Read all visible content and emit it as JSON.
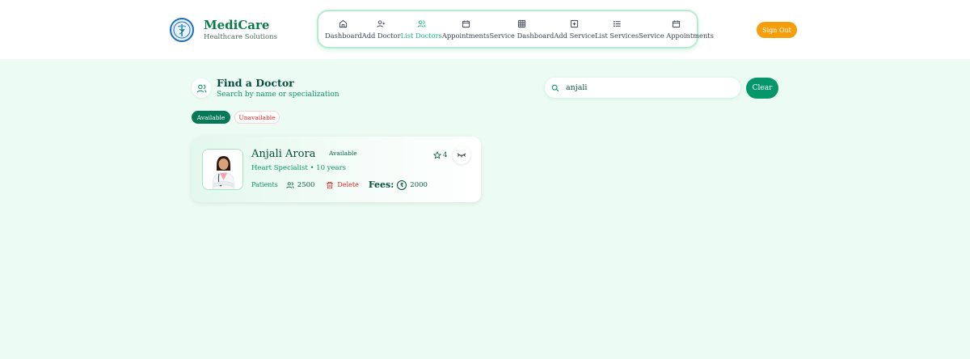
{
  "brand": {
    "name": "MediCare",
    "subtitle": "Healthcare Solutions",
    "logo_icon": "caduceus-icon"
  },
  "nav": {
    "items": [
      {
        "label": "Dashboard",
        "icon": "home-icon",
        "active": false
      },
      {
        "label": "Add Doctor",
        "icon": "user-plus-icon",
        "active": false
      },
      {
        "label": "List Doctors",
        "icon": "users-icon",
        "active": true
      },
      {
        "label": "Appointments",
        "icon": "calendar-icon",
        "active": false
      },
      {
        "label": "Service Dashboard",
        "icon": "grid-icon",
        "active": false
      },
      {
        "label": "Add Service",
        "icon": "plus-square-icon",
        "active": false
      },
      {
        "label": "List Services",
        "icon": "list-icon",
        "active": false
      },
      {
        "label": "Service Appointments",
        "icon": "calendar-icon",
        "active": false
      }
    ],
    "signout_label": "Sign Out"
  },
  "find": {
    "title": "Find a Doctor",
    "subtitle": "Search by name or specialization",
    "search_value": "anjali",
    "clear_label": "Clear",
    "filters": {
      "available": "Available",
      "unavailable": "Unavailable"
    }
  },
  "doctor": {
    "name": "Anjali Arora",
    "status": "Available",
    "rating": "4",
    "specialization": "Heart Specialist • 10 years",
    "patients_label": "Patients",
    "patients_count": "2500",
    "delete_label": "Delete",
    "fees_label": "Fees:",
    "fees_value": "2000"
  },
  "colors": {
    "accent": "#10b981",
    "primary_dark": "#047857",
    "signout": "#f59e0b",
    "danger": "#dc2626",
    "page_bg": "#ecfbf3"
  }
}
